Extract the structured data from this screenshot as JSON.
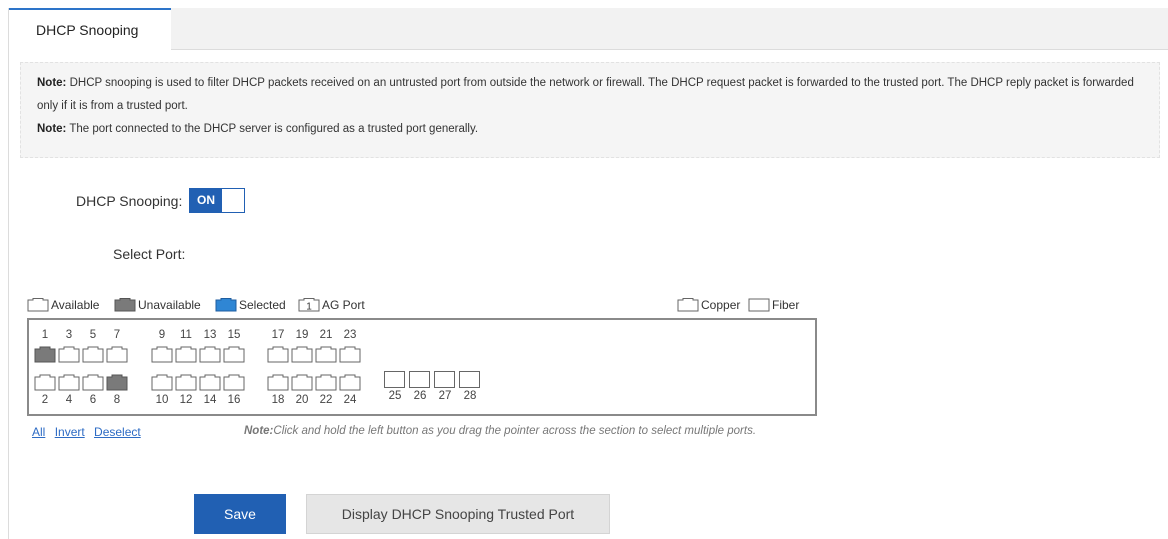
{
  "tab": {
    "label": "DHCP Snooping"
  },
  "notes": [
    {
      "prefix": "Note:",
      "text": " DHCP snooping is used to filter DHCP packets received on an untrusted port from outside the network or firewall. The DHCP request packet is forwarded to the trusted port. The DHCP reply packet is forwarded only if it is from a trusted port."
    },
    {
      "prefix": "Note:",
      "text": " The port connected to the DHCP server is configured as a trusted port generally."
    }
  ],
  "dhcp_snooping": {
    "label": "DHCP Snooping:",
    "state": "ON"
  },
  "select_port": {
    "label": "Select Port:"
  },
  "legend": {
    "available": "Available",
    "unavailable": "Unavailable",
    "selected": "Selected",
    "ag_port": "AG Port",
    "ag_port_number": "1",
    "copper": "Copper",
    "fiber": "Fiber"
  },
  "ports": {
    "top_numbers": [
      "1",
      "3",
      "5",
      "7",
      "9",
      "11",
      "13",
      "15",
      "17",
      "19",
      "21",
      "23"
    ],
    "bottom_numbers": [
      "2",
      "4",
      "6",
      "8",
      "10",
      "12",
      "14",
      "16",
      "18",
      "20",
      "22",
      "24"
    ],
    "fiber_numbers": [
      "25",
      "26",
      "27",
      "28"
    ],
    "unavailable": [
      "1",
      "8"
    ]
  },
  "links": {
    "all": "All",
    "invert": "Invert",
    "deselect": "Deselect"
  },
  "hint": {
    "prefix": "Note:",
    "text": "Click and hold the left button as you drag the pointer across the section to select multiple ports."
  },
  "buttons": {
    "save": "Save",
    "display": "Display DHCP Snooping Trusted Port"
  },
  "colors": {
    "accent": "#2160b3",
    "unavailable": "#7a7a7a",
    "selected": "#2f86d4"
  }
}
